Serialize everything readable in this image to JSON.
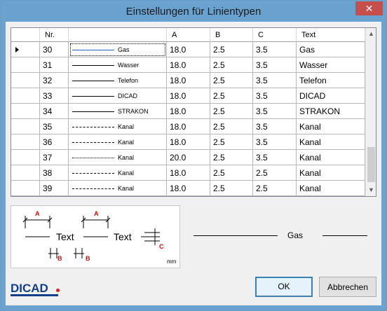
{
  "window": {
    "title": "Einstellungen für Linientypen",
    "close_glyph": "✕"
  },
  "grid": {
    "columns": [
      "",
      "Nr.",
      "",
      "A",
      "B",
      "C",
      "Text"
    ],
    "selected_row": 0,
    "rows": [
      {
        "nr": "30",
        "preview_style": "solid",
        "preview_label": "Gas",
        "a": "18.0",
        "b": "2.5",
        "c": "3.5",
        "text": "Gas"
      },
      {
        "nr": "31",
        "preview_style": "solid",
        "preview_label": "Wasser",
        "a": "18.0",
        "b": "2.5",
        "c": "3.5",
        "text": "Wasser"
      },
      {
        "nr": "32",
        "preview_style": "solid",
        "preview_label": "Telefon",
        "a": "18.0",
        "b": "2.5",
        "c": "3.5",
        "text": "Telefon"
      },
      {
        "nr": "33",
        "preview_style": "solid",
        "preview_label": "DICAD",
        "a": "18.0",
        "b": "2.5",
        "c": "3.5",
        "text": "DICAD"
      },
      {
        "nr": "34",
        "preview_style": "solid",
        "preview_label": "STRAKON",
        "a": "18.0",
        "b": "2.5",
        "c": "3.5",
        "text": "STRAKON"
      },
      {
        "nr": "35",
        "preview_style": "dashed",
        "preview_label": "Kanal",
        "a": "18.0",
        "b": "2.5",
        "c": "3.5",
        "text": "Kanal"
      },
      {
        "nr": "36",
        "preview_style": "dashdot",
        "preview_label": "Kanal",
        "a": "18.0",
        "b": "2.5",
        "c": "3.5",
        "text": "Kanal"
      },
      {
        "nr": "37",
        "preview_style": "dotted",
        "preview_label": "Kanal",
        "a": "20.0",
        "b": "2.5",
        "c": "3.5",
        "text": "Kanal"
      },
      {
        "nr": "38",
        "preview_style": "dashed",
        "preview_label": "Kanal",
        "a": "18.0",
        "b": "2.5",
        "c": "2.5",
        "text": "Kanal"
      },
      {
        "nr": "39",
        "preview_style": "dashdot",
        "preview_label": "Kanal",
        "a": "18.0",
        "b": "2.5",
        "c": "2.5",
        "text": "Kanal"
      }
    ]
  },
  "diagram": {
    "text_left": "Text",
    "text_right": "Text",
    "label_a": "A",
    "label_b": "B",
    "label_c": "C",
    "unit": "mm"
  },
  "sample": {
    "label": "Gas"
  },
  "logo": {
    "text": "DICAD"
  },
  "buttons": {
    "ok": "OK",
    "cancel": "Abbrechen"
  },
  "colors": {
    "title_bar": "#6aa2cf",
    "close_button": "#c74f4b",
    "accent_red": "#d01010",
    "logo_blue": "#123f8a"
  }
}
